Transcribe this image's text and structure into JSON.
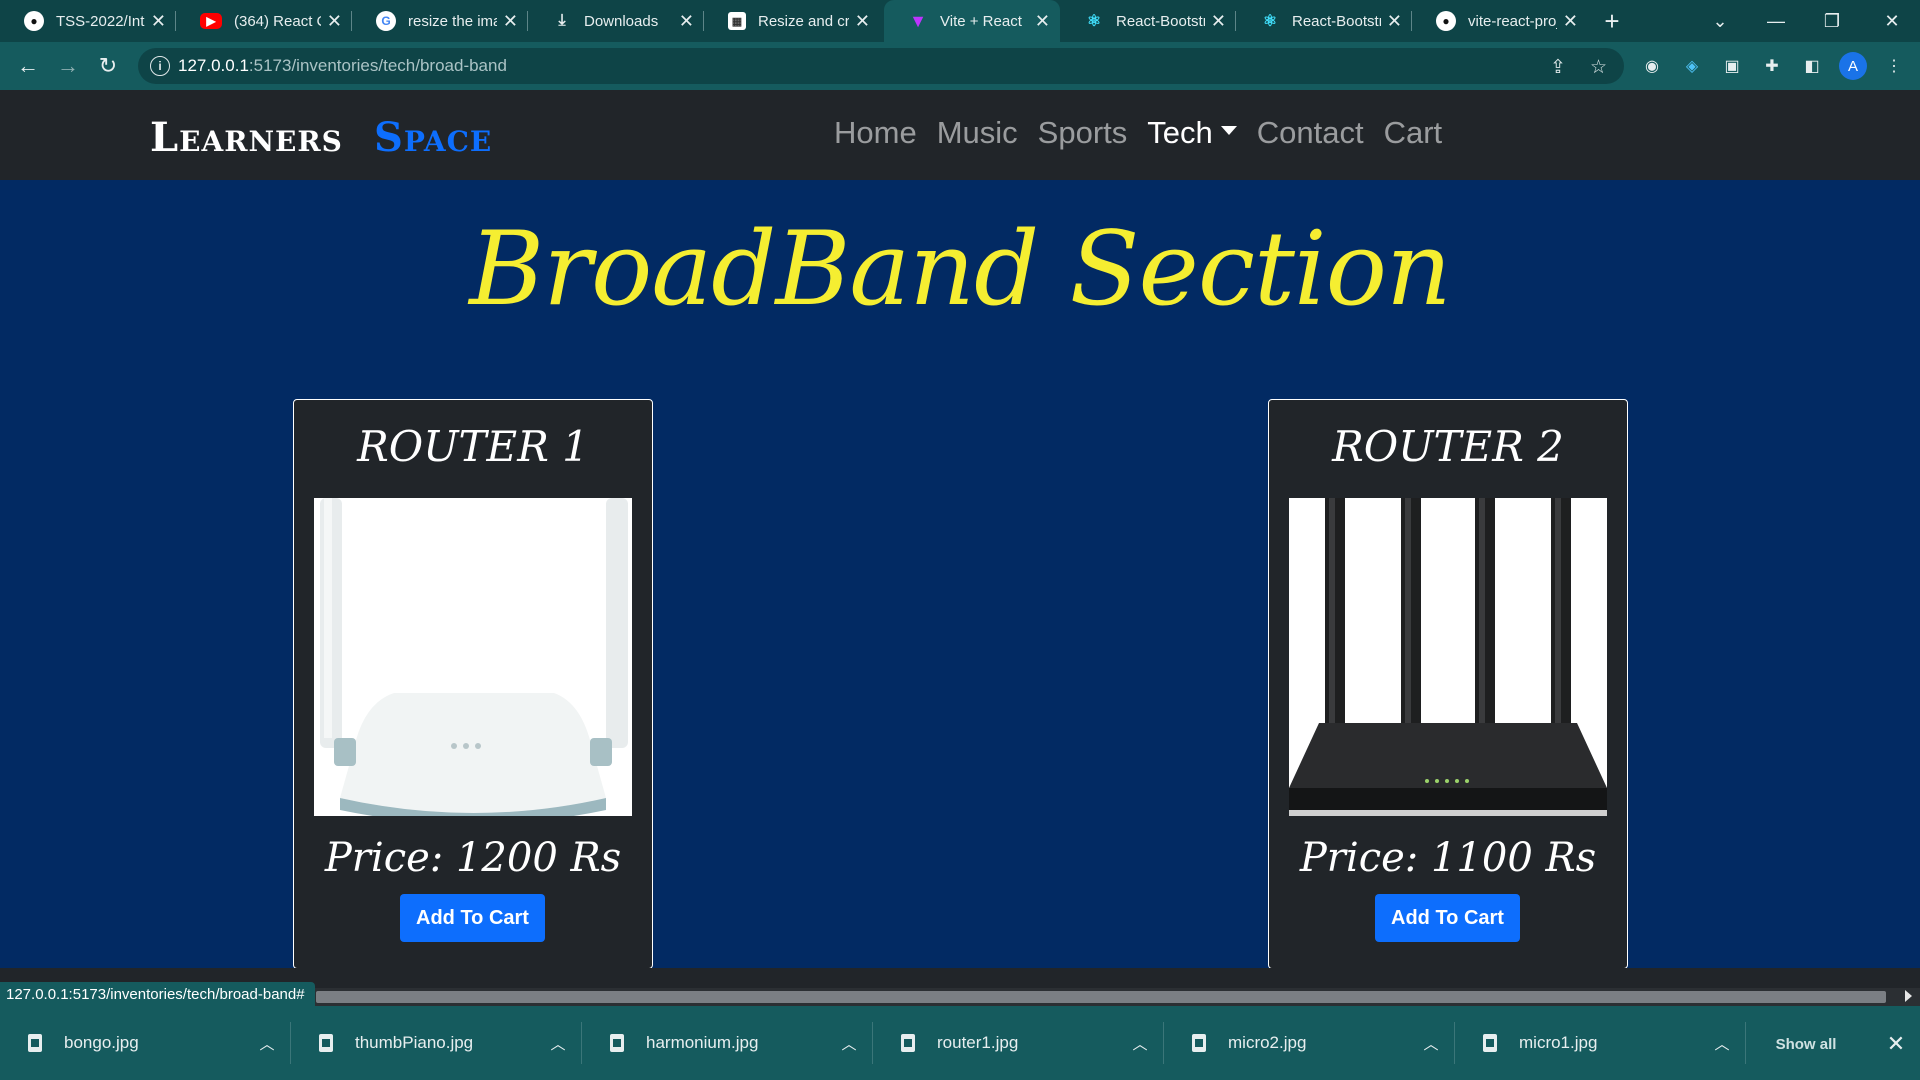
{
  "browser": {
    "tabs": [
      {
        "title": "TSS-2022/Intr",
        "icon": "github-icon",
        "active": false
      },
      {
        "title": "(364) React Cu",
        "icon": "youtube-icon",
        "active": false
      },
      {
        "title": "resize the ima",
        "icon": "google-icon",
        "active": false
      },
      {
        "title": "Downloads",
        "icon": "download-icon",
        "active": false
      },
      {
        "title": "Resize and cro",
        "icon": "image-tool-icon",
        "active": false
      },
      {
        "title": "Vite + React",
        "icon": "vite-icon",
        "active": true
      },
      {
        "title": "React-Bootstra",
        "icon": "react-bootstrap-icon",
        "active": false
      },
      {
        "title": "React-Bootstr",
        "icon": "react-bootstrap-icon",
        "active": false
      },
      {
        "title": "vite-react-proj",
        "icon": "github-icon",
        "active": false
      }
    ],
    "url_host": "127.0.0.1",
    "url_rest": ":5173/inventories/tech/broad-band",
    "profile_initial": "A",
    "status_url": "127.0.0.1:5173/inventories/tech/broad-band#"
  },
  "site": {
    "brand_first": "Learners",
    "brand_second": "Space",
    "nav": [
      "Home",
      "Music",
      "Sports",
      "Tech",
      "Contact",
      "Cart"
    ],
    "active_nav": "Tech",
    "brand_color": "#0d6efd",
    "title_color": "#f5ee31"
  },
  "main": {
    "title": "BroadBand Section",
    "products": [
      {
        "name": "ROUTER 1",
        "price": "Price: 1200 Rs",
        "button": "Add To Cart"
      },
      {
        "name": "ROUTER 2",
        "price": "Price: 1100 Rs",
        "button": "Add To Cart"
      }
    ]
  },
  "downloads": {
    "files": [
      "bongo.jpg",
      "thumbPiano.jpg",
      "harmonium.jpg",
      "router1.jpg",
      "micro2.jpg",
      "micro1.jpg"
    ],
    "show_all": "Show all"
  }
}
